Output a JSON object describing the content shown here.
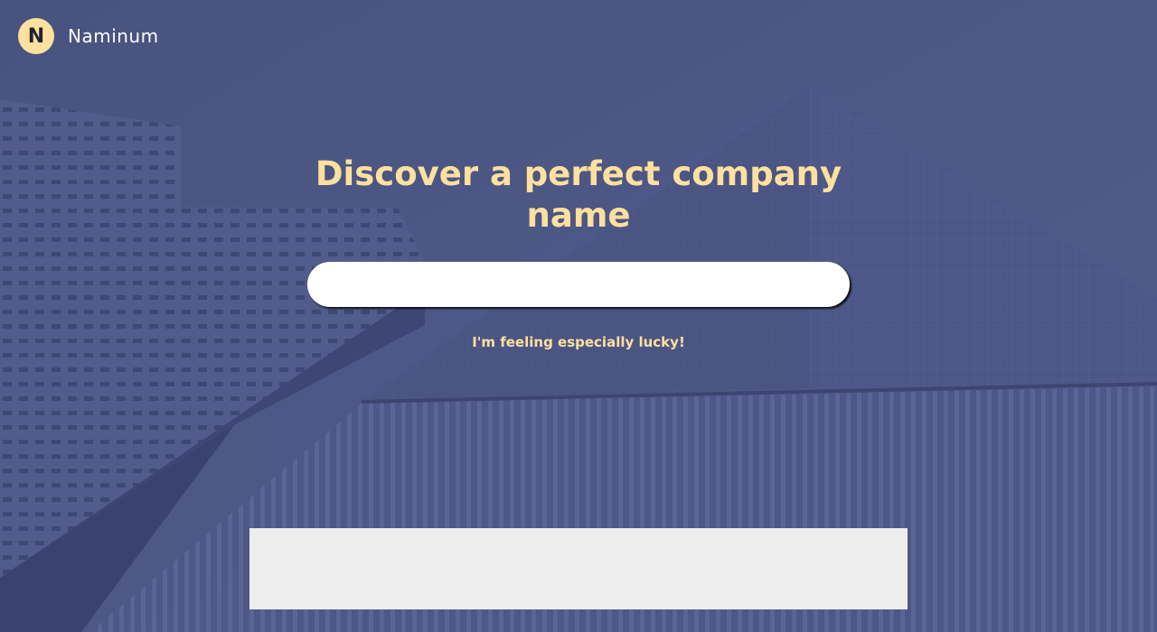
{
  "brand": {
    "logo_letter": "N",
    "name": "Naminum"
  },
  "hero": {
    "title": "Discover a perfect company name"
  },
  "search": {
    "value": "",
    "placeholder": ""
  },
  "actions": {
    "lucky_label": "I'm feeling especially lucky!"
  },
  "colors": {
    "accent": "#ffe09e",
    "overlay": "#45507f",
    "panel": "#ededed"
  }
}
